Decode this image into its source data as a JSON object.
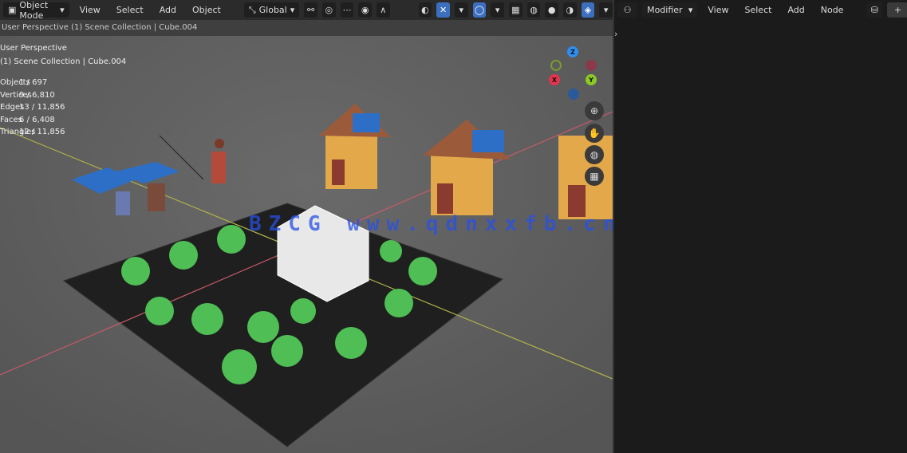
{
  "viewport": {
    "header": {
      "mode": "Object Mode",
      "menus": [
        "View",
        "Select",
        "Add",
        "Object"
      ],
      "transform_orientation": "Global"
    },
    "subheader": "User Perspective (1) Scene Collection | Cube.004",
    "overlay": {
      "line1": "User Perspective",
      "line2": "(1) Scene Collection | Cube.004"
    },
    "stats": [
      {
        "k": "Objects",
        "v": "1 / 697"
      },
      {
        "k": "Vertices",
        "v": "9 / 6,810"
      },
      {
        "k": "Edges",
        "v": "13 / 11,856"
      },
      {
        "k": "Faces",
        "v": "6 / 6,408"
      },
      {
        "k": "Triangles",
        "v": "12 / 11,856"
      }
    ],
    "gizmo": {
      "x": "X",
      "y": "Y",
      "z": "Z",
      "x_color": "#e5334e",
      "y_color": "#8bc925",
      "z_color": "#2c8ff0"
    }
  },
  "right_panel": {
    "editor": "Modifier",
    "menus": [
      "View",
      "Select",
      "Add",
      "Node"
    ]
  },
  "watermark": "BZCG www.qdnxxfb.cn",
  "colors": {
    "accent": "#3d6fbf",
    "viewport_bg": "#5f5f5f",
    "header_bg": "#2b2b2b"
  }
}
